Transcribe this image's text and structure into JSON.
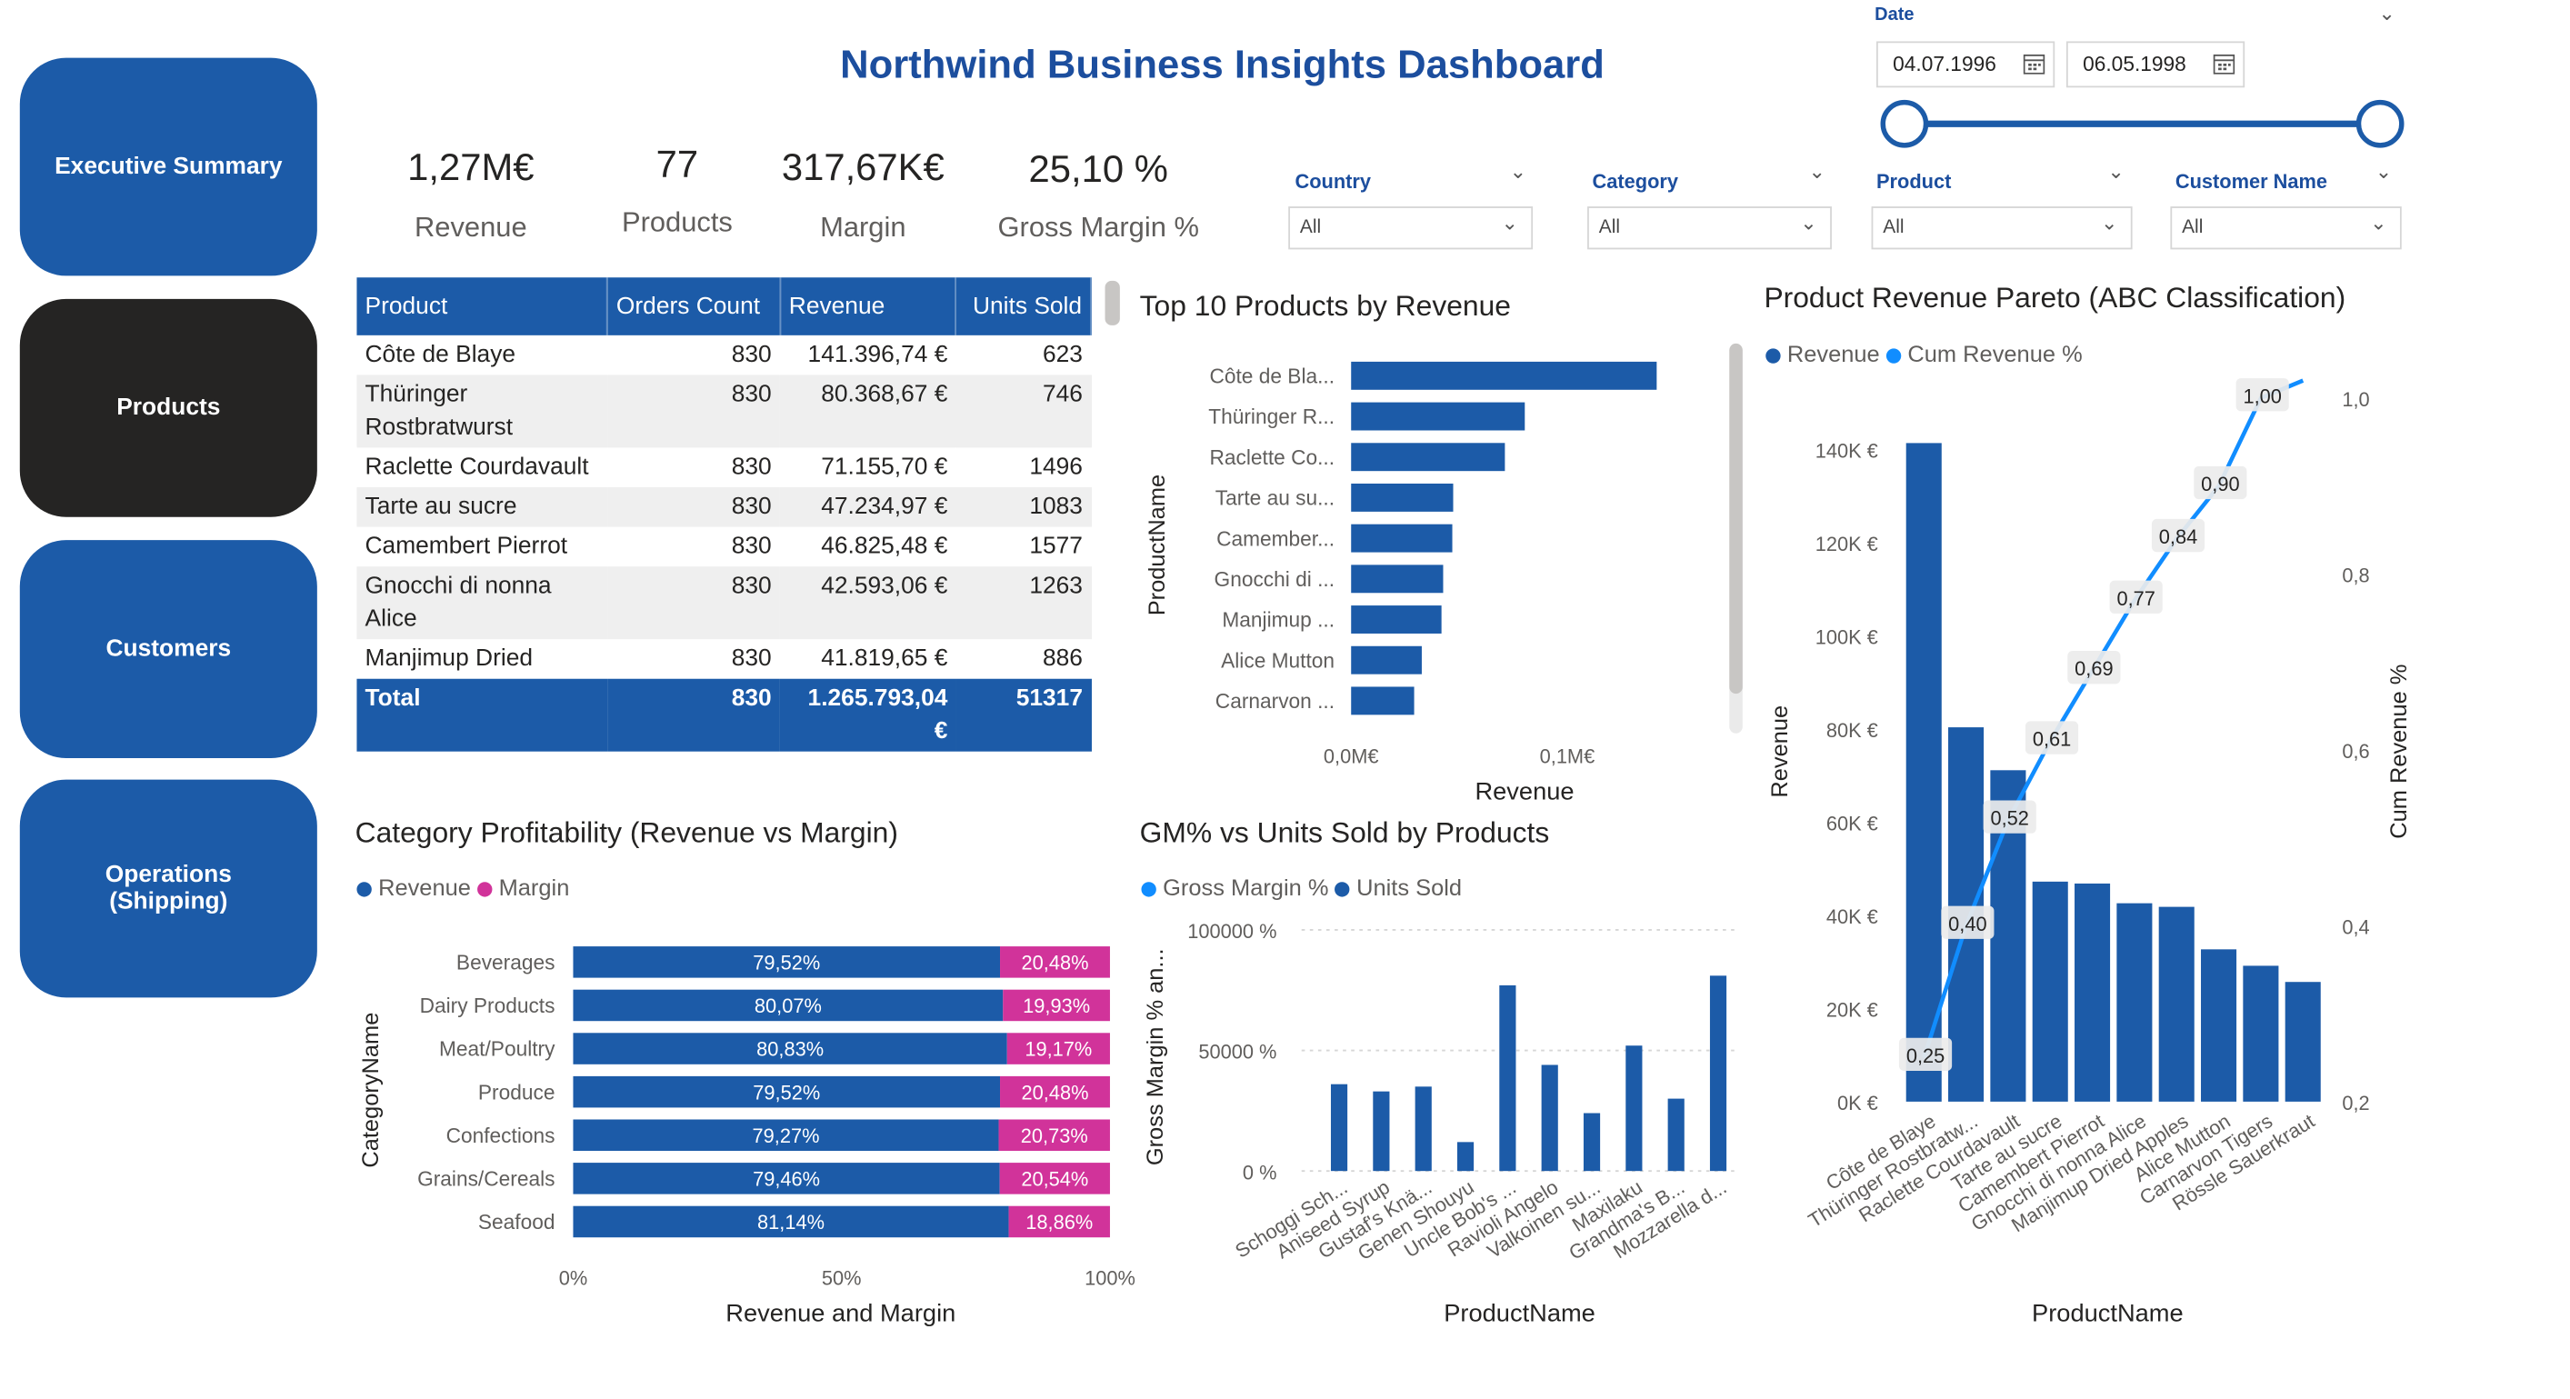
{
  "title": "Northwind Business Insights Dashboard",
  "nav": {
    "executive_summary": "Executive Summary",
    "products": "Products",
    "customers": "Customers",
    "operations_line1": "Operations",
    "operations_line2": "(Shipping)"
  },
  "kpis": {
    "revenue": {
      "value": "1,27M€",
      "label": "Revenue"
    },
    "products": {
      "value": "77",
      "label": "Products"
    },
    "margin": {
      "value": "317,67K€",
      "label": "Margin"
    },
    "gross_margin": {
      "value": "25,10 %",
      "label": "Gross Margin %"
    }
  },
  "date_slicer": {
    "label": "Date",
    "start": "04.07.1996",
    "end": "06.05.1998"
  },
  "slicers": [
    {
      "label": "Country",
      "value": "All"
    },
    {
      "label": "Category",
      "value": "All"
    },
    {
      "label": "Product",
      "value": "All"
    },
    {
      "label": "Customer Name",
      "value": "All"
    }
  ],
  "product_table": {
    "columns": [
      "Product",
      "Orders Count",
      "Revenue",
      "Units Sold"
    ],
    "rows": [
      [
        "Côte de Blaye",
        "830",
        "141.396,74 €",
        "623"
      ],
      [
        "Thüringer Rostbratwurst",
        "830",
        "80.368,67 €",
        "746"
      ],
      [
        "Raclette Courdavault",
        "830",
        "71.155,70 €",
        "1496"
      ],
      [
        "Tarte au sucre",
        "830",
        "47.234,97 €",
        "1083"
      ],
      [
        "Camembert Pierrot",
        "830",
        "46.825,48 €",
        "1577"
      ],
      [
        "Gnocchi di nonna Alice",
        "830",
        "42.593,06 €",
        "1263"
      ],
      [
        "Manjimup Dried",
        "830",
        "41.819,65 €",
        "886"
      ]
    ],
    "total": [
      "Total",
      "830",
      "1.265.793,04 €",
      "51317"
    ]
  },
  "top10": {
    "title": "Top 10 Products by Revenue",
    "ylabel": "ProductName",
    "xlabel": "Revenue",
    "xticks": [
      "0,0M€",
      "0,1M€"
    ],
    "color": "#1C5BA8"
  },
  "category": {
    "title": "Category Profitability (Revenue vs Margin)",
    "legend": [
      "Revenue",
      "Margin"
    ],
    "ylabel": "CategoryName",
    "xlabel": "Revenue and Margin",
    "xticks": [
      "0%",
      "50%",
      "100%"
    ]
  },
  "gm_units": {
    "title": "GM% vs Units Sold by Products",
    "legend": [
      "Gross Margin %",
      "Units Sold"
    ],
    "ylabel": "Gross Margin % an...",
    "xlabel": "ProductName",
    "yticks": [
      "100000 %",
      "50000 %",
      "0 %"
    ]
  },
  "pareto": {
    "title": "Product Revenue Pareto (ABC Classification)",
    "legend": [
      "Revenue",
      "Cum Revenue %"
    ],
    "ylabel": "Revenue",
    "y2label": "Cum Revenue %",
    "xlabel": "ProductName",
    "yticks": [
      "140K €",
      "120K €",
      "100K €",
      "80K €",
      "60K €",
      "40K €",
      "20K €",
      "0K €"
    ],
    "y2ticks": [
      "1,0",
      "0,8",
      "0,6",
      "0,4",
      "0,2"
    ]
  },
  "chart_data": [
    {
      "type": "bar",
      "title": "Top 10 Products by Revenue",
      "orientation": "horizontal",
      "categories": [
        "Côte de Bla...",
        "Thüringer R...",
        "Raclette Co...",
        "Tarte au su...",
        "Camember...",
        "Gnocchi di ...",
        "Manjimup ...",
        "Alice Mutton",
        "Carnarvon ..."
      ],
      "values": [
        141397,
        80369,
        71156,
        47235,
        46825,
        42593,
        41820,
        32698,
        29171
      ],
      "xlabel": "Revenue",
      "ylabel": "ProductName",
      "xlim": [
        0,
        150000
      ]
    },
    {
      "type": "bar",
      "title": "Category Profitability (Revenue vs Margin)",
      "orientation": "horizontal",
      "stacked": true,
      "categories": [
        "Beverages",
        "Dairy Products",
        "Meat/Poultry",
        "Produce",
        "Confections",
        "Grains/Cereals",
        "Seafood"
      ],
      "series": [
        {
          "name": "Revenue",
          "values": [
            79.52,
            80.07,
            80.83,
            79.52,
            79.27,
            79.46,
            81.14
          ],
          "labels": [
            "79,52%",
            "80,07%",
            "80,83%",
            "79,52%",
            "79,27%",
            "79,46%",
            "81,14%"
          ]
        },
        {
          "name": "Margin",
          "values": [
            20.48,
            19.93,
            19.17,
            20.48,
            20.73,
            20.54,
            18.86
          ],
          "labels": [
            "20,48%",
            "19,93%",
            "19,17%",
            "20,48%",
            "20,73%",
            "20,54%",
            "18,86%"
          ]
        }
      ],
      "xlabel": "Revenue and Margin",
      "ylabel": "CategoryName",
      "xlim": [
        0,
        100
      ],
      "colors": [
        "#1C5BA8",
        "#D1339A"
      ]
    },
    {
      "type": "bar",
      "title": "GM% vs Units Sold by Products",
      "categories": [
        "Schoggi Sch...",
        "Aniseed Syrup",
        "Gustaf's Knä...",
        "Genen Shouyu",
        "Uncle Bob's ...",
        "Ravioli Angelo",
        "Valkoinen su...",
        "Maxilaku",
        "Grandma's B...",
        "Mozzarella d..."
      ],
      "series": [
        {
          "name": "Gross Margin %",
          "values": [
            0,
            0,
            0,
            0,
            0,
            0,
            0,
            0,
            0,
            0
          ]
        },
        {
          "name": "Units Sold",
          "values": [
            36000,
            33000,
            35000,
            12000,
            77000,
            44000,
            24000,
            52000,
            30000,
            81000
          ]
        }
      ],
      "xlabel": "ProductName",
      "ylabel": "Gross Margin % an...",
      "ylim": [
        0,
        100000
      ],
      "colors": [
        "#118DFF",
        "#1C5BA8"
      ]
    },
    {
      "type": "bar",
      "title": "Product Revenue Pareto (ABC Classification)",
      "categories": [
        "Côte de Blaye",
        "Thüringer Rostbratw...",
        "Raclette Courdavault",
        "Tarte au sucre",
        "Camembert Pierrot",
        "Gnocchi di nonna Alice",
        "Manjimup Dried Apples",
        "Alice Mutton",
        "Carnarvon Tigers",
        "Rössle Sauerkraut"
      ],
      "series": [
        {
          "name": "Revenue",
          "values": [
            141397,
            80369,
            71156,
            47235,
            46825,
            42593,
            41820,
            32698,
            29171,
            25696
          ]
        },
        {
          "name": "Cum Revenue %",
          "axis": "secondary",
          "values": [
            0.25,
            0.4,
            0.52,
            0.61,
            0.69,
            0.77,
            0.84,
            0.9,
            1.0,
            1.02
          ]
        }
      ],
      "point_labels": [
        "0,25",
        "0,40",
        "0,52",
        "0,61",
        "0,69",
        "0,77",
        "0,84",
        "0,90",
        "1,00"
      ],
      "xlabel": "ProductName",
      "ylabel": "Revenue",
      "y2label": "Cum Revenue %",
      "ylim": [
        0,
        150000
      ],
      "y2lim": [
        0.2,
        1.0
      ],
      "colors": [
        "#1C5BA8",
        "#118DFF"
      ]
    }
  ]
}
